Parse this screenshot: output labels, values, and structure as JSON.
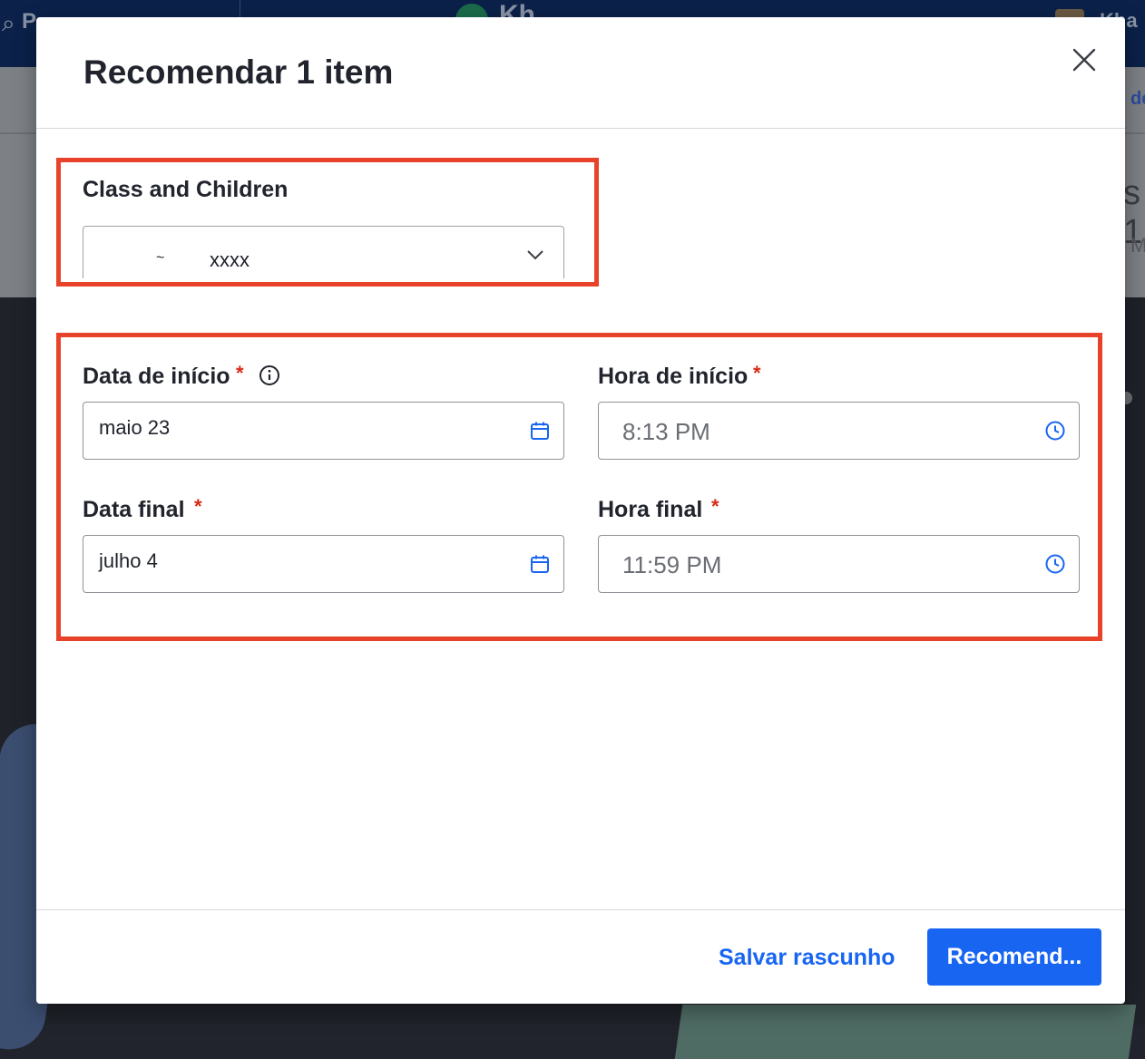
{
  "background": {
    "search_text": "P",
    "brand_text": "Kh",
    "user_text": "Kha",
    "right_link": "de",
    "right_big": "s 1",
    "right_small": "M"
  },
  "modal": {
    "title": "Recomendar 1 item",
    "close_icon": "close-icon"
  },
  "class_field": {
    "label": "Class and Children",
    "selected_value": "xxxx",
    "partial_glyph": "~"
  },
  "start_date": {
    "label": "Data de início",
    "required_mark": "*",
    "value": "maio 23",
    "icon": "calendar-icon",
    "info_icon": "info-icon"
  },
  "start_time": {
    "label": "Hora de início",
    "required_mark": "*",
    "value": "8:13 PM",
    "icon": "clock-icon"
  },
  "end_date": {
    "label": "Data final",
    "required_mark": "*",
    "value": "julho 4",
    "icon": "calendar-icon"
  },
  "end_time": {
    "label": "Hora final",
    "required_mark": "*",
    "value": "11:59 PM",
    "icon": "clock-icon"
  },
  "footer": {
    "save_draft_label": "Salvar rascunho",
    "recommend_label": "Recomend..."
  },
  "colors": {
    "accent": "#1865f2",
    "annotation": "#e8432a",
    "required": "#d92916"
  }
}
